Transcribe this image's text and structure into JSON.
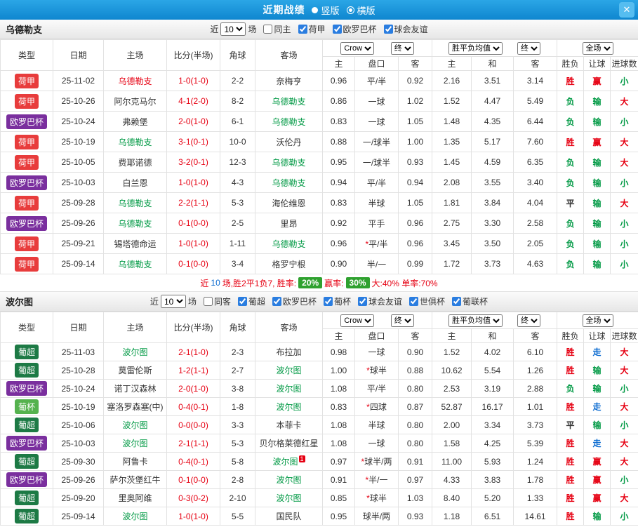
{
  "topbar": {
    "title": "近期战绩",
    "layout_options": [
      {
        "label": "竖版",
        "selected": false
      },
      {
        "label": "横版",
        "selected": true
      }
    ],
    "close_label": "✕"
  },
  "filter_labels": {
    "near": "近",
    "count": "10",
    "games": "场"
  },
  "table_header": {
    "static_columns": [
      "类型",
      "日期",
      "主场",
      "比分(半场)",
      "角球",
      "客场"
    ],
    "odds_groups": {
      "group1": [
        "Crow",
        "终"
      ],
      "group2": [
        "胜平负均值",
        "终"
      ],
      "group3": [
        "全场"
      ]
    },
    "sub_columns": [
      "主",
      "盘口",
      "客",
      "主",
      "和",
      "客",
      "胜负",
      "让球",
      "进球数"
    ]
  },
  "colors": {
    "red": "#e60012",
    "green": "#009944",
    "blue": "#0b6bd0",
    "black": "#333333",
    "badge_green": "#2fa12f"
  },
  "league_colors": {
    "荷甲": "#e83c3c",
    "欧罗巴杯": "#7a2f9e",
    "葡超": "#1d7a45",
    "葡杯": "#55b24e"
  },
  "result_colors": {
    "胜": "red",
    "负": "green",
    "平": "black",
    "赢": "red",
    "输": "green",
    "走": "blue",
    "大": "red",
    "小": "green"
  },
  "sections": [
    {
      "team": "乌德勒支",
      "checkboxes": [
        {
          "label": "同主",
          "checked": false
        },
        {
          "label": "荷甲",
          "checked": true
        },
        {
          "label": "欧罗巴杯",
          "checked": true
        },
        {
          "label": "球会友谊",
          "checked": true
        }
      ],
      "rows": [
        {
          "league": "荷甲",
          "date": "25-11-02",
          "home": {
            "name": "乌德勒支",
            "color": "red"
          },
          "score": "1-0(1-0)",
          "corners": "2-2",
          "away": {
            "name": "奈梅亨",
            "color": "black"
          },
          "odds": [
            "0.96",
            "平/半",
            "0.92"
          ],
          "avg": [
            "2.16",
            "3.51",
            "3.14"
          ],
          "results": [
            "胜",
            "赢",
            "小"
          ]
        },
        {
          "league": "荷甲",
          "date": "25-10-26",
          "home": {
            "name": "阿尔克马尔",
            "color": "black"
          },
          "score": "4-1(2-0)",
          "corners": "8-2",
          "away": {
            "name": "乌德勒支",
            "color": "green"
          },
          "odds": [
            "0.86",
            "一球",
            "1.02"
          ],
          "avg": [
            "1.52",
            "4.47",
            "5.49"
          ],
          "results": [
            "负",
            "输",
            "大"
          ]
        },
        {
          "league": "欧罗巴杯",
          "date": "25-10-24",
          "home": {
            "name": "弗赖堡",
            "color": "black"
          },
          "score": "2-0(1-0)",
          "corners": "6-1",
          "away": {
            "name": "乌德勒支",
            "color": "green"
          },
          "odds": [
            "0.83",
            "一球",
            "1.05"
          ],
          "avg": [
            "1.48",
            "4.35",
            "6.44"
          ],
          "results": [
            "负",
            "输",
            "小"
          ]
        },
        {
          "league": "荷甲",
          "date": "25-10-19",
          "home": {
            "name": "乌德勒支",
            "color": "green"
          },
          "score": "3-1(0-1)",
          "corners": "10-0",
          "away": {
            "name": "沃伦丹",
            "color": "black"
          },
          "odds": [
            "0.88",
            "一/球半",
            "1.00"
          ],
          "avg": [
            "1.35",
            "5.17",
            "7.60"
          ],
          "results": [
            "胜",
            "赢",
            "大"
          ]
        },
        {
          "league": "荷甲",
          "date": "25-10-05",
          "home": {
            "name": "费耶诺德",
            "color": "black"
          },
          "score": "3-2(0-1)",
          "corners": "12-3",
          "away": {
            "name": "乌德勒支",
            "color": "green"
          },
          "odds": [
            "0.95",
            "一/球半",
            "0.93"
          ],
          "avg": [
            "1.45",
            "4.59",
            "6.35"
          ],
          "results": [
            "负",
            "输",
            "大"
          ]
        },
        {
          "league": "欧罗巴杯",
          "date": "25-10-03",
          "home": {
            "name": "白兰恩",
            "color": "black"
          },
          "score": "1-0(1-0)",
          "corners": "4-3",
          "away": {
            "name": "乌德勒支",
            "color": "green"
          },
          "odds": [
            "0.94",
            "平/半",
            "0.94"
          ],
          "avg": [
            "2.08",
            "3.55",
            "3.40"
          ],
          "results": [
            "负",
            "输",
            "小"
          ]
        },
        {
          "league": "荷甲",
          "date": "25-09-28",
          "home": {
            "name": "乌德勒支",
            "color": "green"
          },
          "score": "2-2(1-1)",
          "corners": "5-3",
          "away": {
            "name": "海伦维恩",
            "color": "black"
          },
          "odds": [
            "0.83",
            "半球",
            "1.05"
          ],
          "avg": [
            "1.81",
            "3.84",
            "4.04"
          ],
          "results": [
            "平",
            "输",
            "大"
          ]
        },
        {
          "league": "欧罗巴杯",
          "date": "25-09-26",
          "home": {
            "name": "乌德勒支",
            "color": "green"
          },
          "score": "0-1(0-0)",
          "corners": "2-5",
          "away": {
            "name": "里昂",
            "color": "black"
          },
          "odds": [
            "0.92",
            "平手",
            "0.96"
          ],
          "avg": [
            "2.75",
            "3.30",
            "2.58"
          ],
          "results": [
            "负",
            "输",
            "小"
          ]
        },
        {
          "league": "荷甲",
          "date": "25-09-21",
          "home": {
            "name": "锡塔德命运",
            "color": "black"
          },
          "score": "1-0(1-0)",
          "corners": "1-11",
          "away": {
            "name": "乌德勒支",
            "color": "green"
          },
          "odds": [
            "0.96",
            "*平/半",
            "0.96"
          ],
          "avg": [
            "3.45",
            "3.50",
            "2.05"
          ],
          "results": [
            "负",
            "输",
            "小"
          ]
        },
        {
          "league": "荷甲",
          "date": "25-09-14",
          "home": {
            "name": "乌德勒支",
            "color": "green"
          },
          "score": "0-1(0-0)",
          "corners": "3-4",
          "away": {
            "name": "格罗宁根",
            "color": "black"
          },
          "odds": [
            "0.90",
            "半/一",
            "0.99"
          ],
          "avg": [
            "1.72",
            "3.73",
            "4.63"
          ],
          "results": [
            "负",
            "输",
            "小"
          ]
        }
      ],
      "summary": [
        {
          "text": "近",
          "color": "red"
        },
        {
          "text": "10",
          "color": "blue"
        },
        {
          "text": "场,胜2平1负7, 胜率: ",
          "color": "red"
        },
        {
          "text": "20%",
          "badge": true
        },
        {
          "text": " 赢率: ",
          "color": "red"
        },
        {
          "text": "30%",
          "badge": true
        },
        {
          "text": " 大:40% 单率:70%",
          "color": "red"
        }
      ]
    },
    {
      "team": "波尔图",
      "checkboxes": [
        {
          "label": "同客",
          "checked": false
        },
        {
          "label": "葡超",
          "checked": true
        },
        {
          "label": "欧罗巴杯",
          "checked": true
        },
        {
          "label": "葡杯",
          "checked": true
        },
        {
          "label": "球会友谊",
          "checked": true
        },
        {
          "label": "世俱杯",
          "checked": true
        },
        {
          "label": "葡联杯",
          "checked": true
        }
      ],
      "rows": [
        {
          "league": "葡超",
          "date": "25-11-03",
          "home": {
            "name": "波尔图",
            "color": "green"
          },
          "score": "2-1(1-0)",
          "corners": "2-3",
          "away": {
            "name": "布拉加",
            "color": "black"
          },
          "odds": [
            "0.98",
            "一球",
            "0.90"
          ],
          "avg": [
            "1.52",
            "4.02",
            "6.10"
          ],
          "results": [
            "胜",
            "走",
            "大"
          ]
        },
        {
          "league": "葡超",
          "date": "25-10-28",
          "home": {
            "name": "莫雷伦斯",
            "color": "black"
          },
          "score": "1-2(1-1)",
          "corners": "2-7",
          "away": {
            "name": "波尔图",
            "color": "green"
          },
          "odds": [
            "1.00",
            "*球半",
            "0.88"
          ],
          "avg": [
            "10.62",
            "5.54",
            "1.26"
          ],
          "results": [
            "胜",
            "输",
            "大"
          ]
        },
        {
          "league": "欧罗巴杯",
          "date": "25-10-24",
          "home": {
            "name": "诺丁汉森林",
            "color": "black"
          },
          "score": "2-0(1-0)",
          "corners": "3-8",
          "away": {
            "name": "波尔图",
            "color": "green"
          },
          "odds": [
            "1.08",
            "平/半",
            "0.80"
          ],
          "avg": [
            "2.53",
            "3.19",
            "2.88"
          ],
          "results": [
            "负",
            "输",
            "小"
          ]
        },
        {
          "league": "葡杯",
          "date": "25-10-19",
          "home": {
            "name": "塞洛罗森塞(中)",
            "color": "black"
          },
          "score": "0-4(0-1)",
          "corners": "1-8",
          "away": {
            "name": "波尔图",
            "color": "green"
          },
          "odds": [
            "0.83",
            "*四球",
            "0.87"
          ],
          "avg": [
            "52.87",
            "16.17",
            "1.01"
          ],
          "results": [
            "胜",
            "走",
            "大"
          ]
        },
        {
          "league": "葡超",
          "date": "25-10-06",
          "home": {
            "name": "波尔图",
            "color": "green"
          },
          "score": "0-0(0-0)",
          "corners": "3-3",
          "away": {
            "name": "本菲卡",
            "color": "black"
          },
          "odds": [
            "1.08",
            "半球",
            "0.80"
          ],
          "avg": [
            "2.00",
            "3.34",
            "3.73"
          ],
          "results": [
            "平",
            "输",
            "小"
          ]
        },
        {
          "league": "欧罗巴杯",
          "date": "25-10-03",
          "home": {
            "name": "波尔图",
            "color": "green"
          },
          "score": "2-1(1-1)",
          "corners": "5-3",
          "away": {
            "name": "贝尔格莱德红星",
            "color": "black"
          },
          "odds": [
            "1.08",
            "一球",
            "0.80"
          ],
          "avg": [
            "1.58",
            "4.25",
            "5.39"
          ],
          "results": [
            "胜",
            "走",
            "大"
          ]
        },
        {
          "league": "葡超",
          "date": "25-09-30",
          "home": {
            "name": "阿鲁卡",
            "color": "black"
          },
          "score": "0-4(0-1)",
          "corners": "5-8",
          "away": {
            "name": "波尔图",
            "color": "green",
            "card": "1"
          },
          "odds": [
            "0.97",
            "*球半/两",
            "0.91"
          ],
          "avg": [
            "11.00",
            "5.93",
            "1.24"
          ],
          "results": [
            "胜",
            "赢",
            "大"
          ]
        },
        {
          "league": "欧罗巴杯",
          "date": "25-09-26",
          "home": {
            "name": "萨尔茨堡红牛",
            "color": "black"
          },
          "score": "0-1(0-0)",
          "corners": "2-8",
          "away": {
            "name": "波尔图",
            "color": "green"
          },
          "odds": [
            "0.91",
            "*半/一",
            "0.97"
          ],
          "avg": [
            "4.33",
            "3.83",
            "1.78"
          ],
          "results": [
            "胜",
            "赢",
            "小"
          ]
        },
        {
          "league": "葡超",
          "date": "25-09-20",
          "home": {
            "name": "里奥阿维",
            "color": "black"
          },
          "score": "0-3(0-2)",
          "corners": "2-10",
          "away": {
            "name": "波尔图",
            "color": "green"
          },
          "odds": [
            "0.85",
            "*球半",
            "1.03"
          ],
          "avg": [
            "8.40",
            "5.20",
            "1.33"
          ],
          "results": [
            "胜",
            "赢",
            "大"
          ]
        },
        {
          "league": "葡超",
          "date": "25-09-14",
          "home": {
            "name": "波尔图",
            "color": "green"
          },
          "score": "1-0(1-0)",
          "corners": "5-5",
          "away": {
            "name": "国民队",
            "color": "black"
          },
          "odds": [
            "0.95",
            "球半/两",
            "0.93"
          ],
          "avg": [
            "1.18",
            "6.51",
            "14.61"
          ],
          "results": [
            "胜",
            "输",
            "小"
          ]
        }
      ]
    }
  ]
}
